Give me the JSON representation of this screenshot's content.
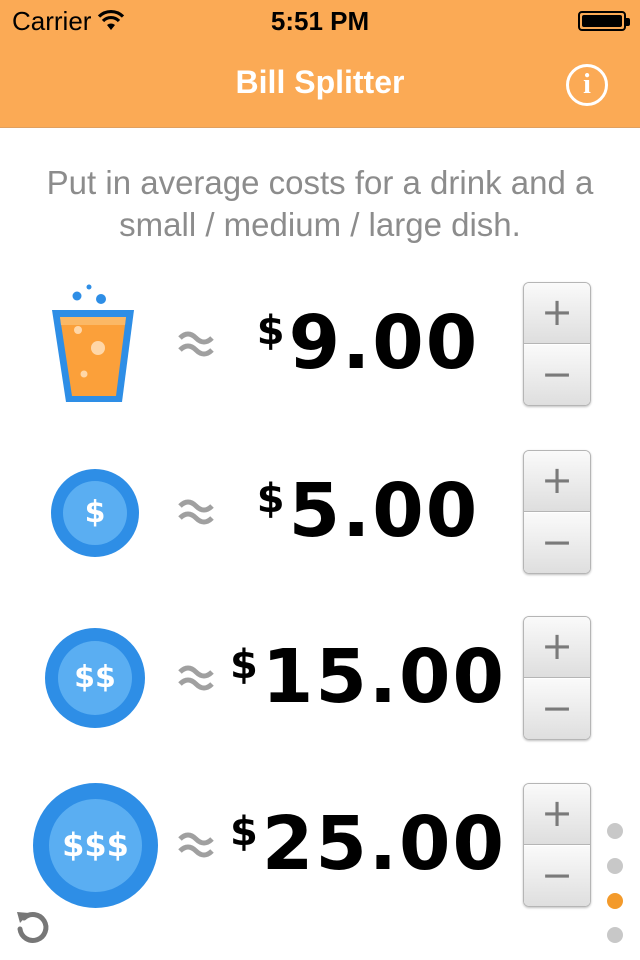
{
  "status_bar": {
    "carrier": "Carrier",
    "time": "5:51 PM"
  },
  "nav": {
    "title": "Bill Splitter",
    "info_glyph": "i"
  },
  "instructions": "Put in average costs for a drink and a small / medium / large dish.",
  "rows": [
    {
      "icon": "drink-glass-icon",
      "approx": "≈",
      "currency": "$",
      "amount": "9.00"
    },
    {
      "icon": "small-dish-coin-icon",
      "coin_label": "$",
      "approx": "≈",
      "currency": "$",
      "amount": "5.00"
    },
    {
      "icon": "medium-dish-coin-icon",
      "coin_label": "$$",
      "approx": "≈",
      "currency": "$",
      "amount": "15.00"
    },
    {
      "icon": "large-dish-coin-icon",
      "coin_label": "$$$",
      "approx": "≈",
      "currency": "$",
      "amount": "25.00"
    }
  ],
  "stepper": {
    "plus": "+",
    "minus": "−"
  },
  "page_indicator": {
    "pages": 4,
    "current": 3
  },
  "colors": {
    "nav_background": "#FBAA55",
    "accent_blue": "#2E8EE6",
    "drink_orange": "#FBA03A",
    "active_dot": "#F39A2B"
  }
}
